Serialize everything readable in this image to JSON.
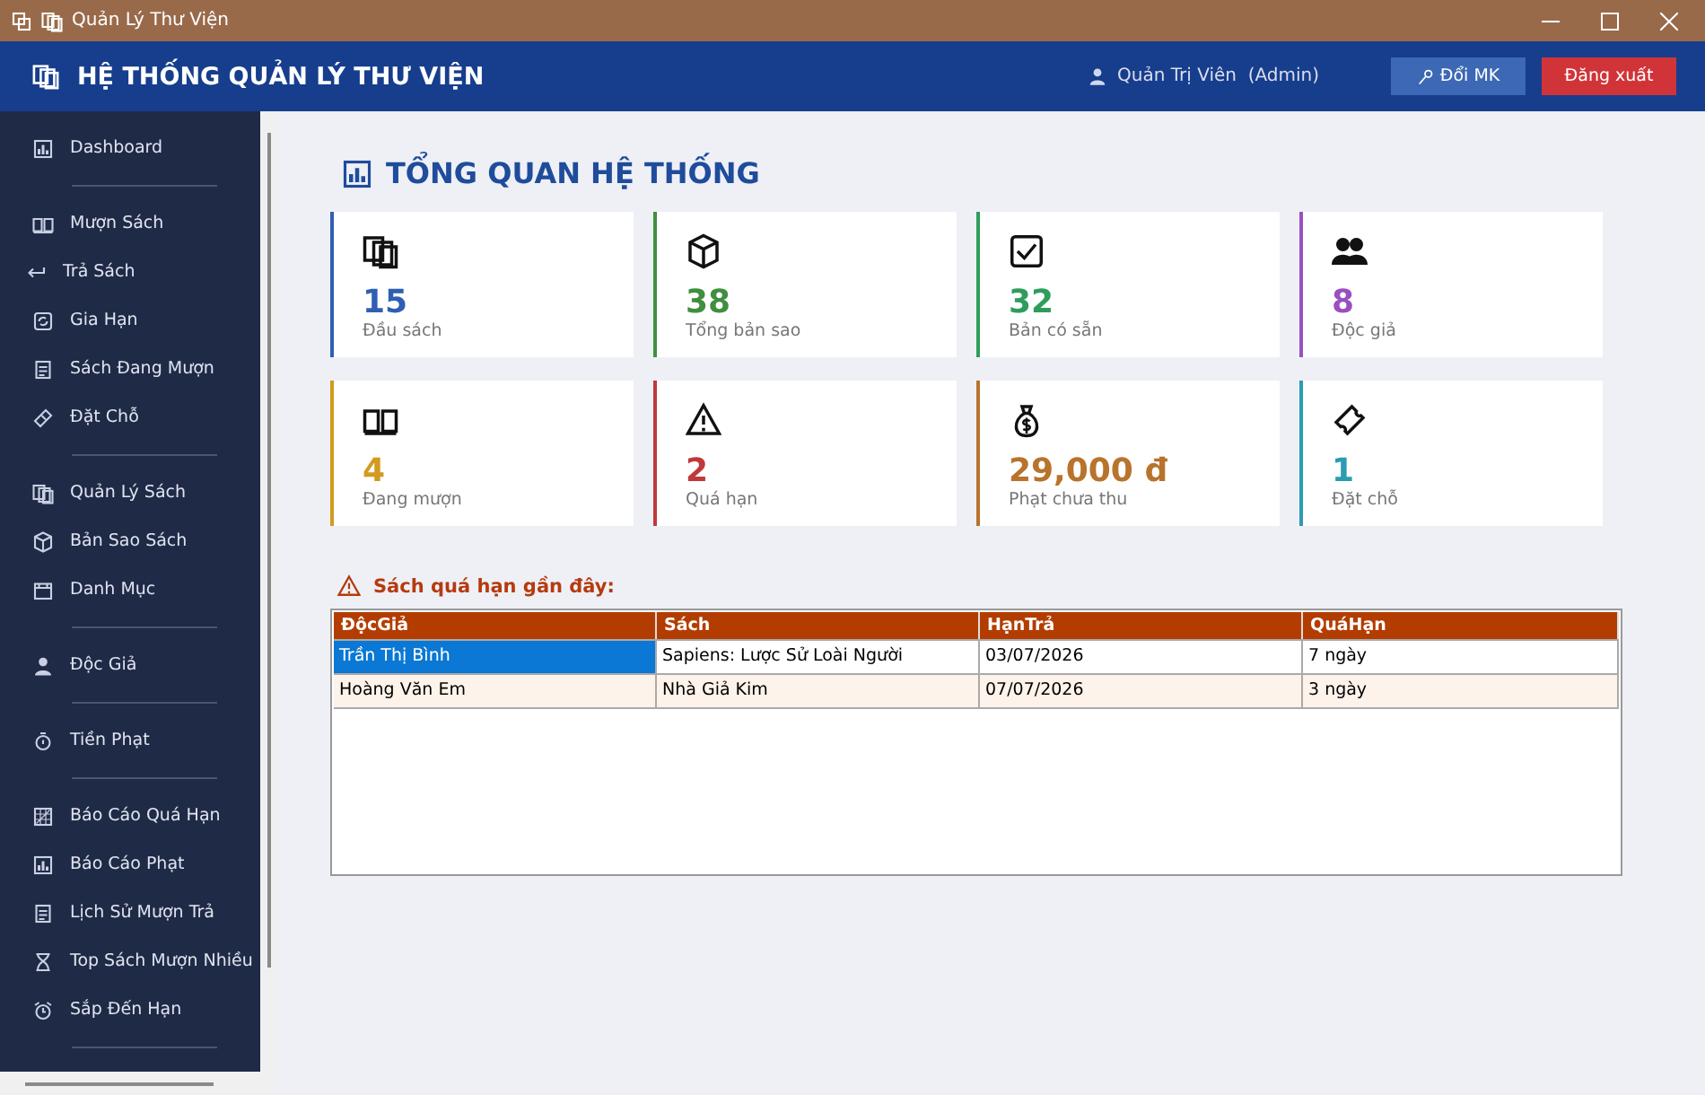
{
  "window": {
    "title": "Quản Lý Thư Viện"
  },
  "header": {
    "title": "HỆ THỐNG QUẢN LÝ THƯ VIỆN",
    "user": "Quản Trị Viên  (Admin)",
    "buttons": [
      "Đổi MK",
      "Đăng xuất"
    ]
  },
  "sidebar": {
    "items": [
      {
        "kind": "item",
        "label": "Dashboard"
      },
      {
        "kind": "separator"
      },
      {
        "kind": "item",
        "label": "Mượn Sách"
      },
      {
        "kind": "item",
        "label": "Trả Sách"
      },
      {
        "kind": "item",
        "label": "Gia Hạn"
      },
      {
        "kind": "item",
        "label": "Sách Đang Mượn"
      },
      {
        "kind": "item",
        "label": "Đặt Chỗ"
      },
      {
        "kind": "separator"
      },
      {
        "kind": "item",
        "label": "Quản Lý Sách"
      },
      {
        "kind": "item",
        "label": "Bản Sao Sách"
      },
      {
        "kind": "item",
        "label": "Danh Mục"
      },
      {
        "kind": "separator"
      },
      {
        "kind": "item",
        "label": "Độc Giả"
      },
      {
        "kind": "separator"
      },
      {
        "kind": "item",
        "label": "Tiền Phạt"
      },
      {
        "kind": "separator"
      },
      {
        "kind": "item",
        "label": "Báo Cáo Quá Hạn"
      },
      {
        "kind": "item",
        "label": "Báo Cáo Phạt"
      },
      {
        "kind": "item",
        "label": "Lịch Sử Mượn Trả"
      },
      {
        "kind": "item",
        "label": "Top Sách Mượn Nhiều"
      },
      {
        "kind": "item",
        "label": "Sắp Đến Hạn"
      },
      {
        "kind": "separator"
      }
    ]
  },
  "overview": {
    "title": "TỔNG QUAN HỆ THỐNG",
    "cards": [
      {
        "value": "15",
        "label": "Đầu sách",
        "color": "#2f5fb3"
      },
      {
        "value": "38",
        "label": "Tổng bản sao",
        "color": "#3f8f3f"
      },
      {
        "value": "32",
        "label": "Bản có sẵn",
        "color": "#2e9d5c"
      },
      {
        "value": "8",
        "label": "Độc giả",
        "color": "#9a4fc0"
      },
      {
        "value": "4",
        "label": "Đang mượn",
        "color": "#d39a1f"
      },
      {
        "value": "2",
        "label": "Quá hạn",
        "color": "#c0393b"
      },
      {
        "value": "29,000 đ",
        "label": "Phạt chưa thu",
        "color": "#b8732c"
      },
      {
        "value": "1",
        "label": "Đặt chỗ",
        "color": "#2a9bb3"
      }
    ]
  },
  "overdue": {
    "title": "Sách quá hạn gần đây:",
    "table": {
      "columns": [
        "ĐộcGiả",
        "Sách",
        "HạnTrả",
        "QuáHạn"
      ],
      "rows": [
        {
          "selected": true,
          "cells": [
            "Trần Thị Bình",
            "Sapiens: Lược Sử Loài Người",
            "03/07/2026",
            "7 ngày"
          ]
        },
        {
          "selected": false,
          "cells": [
            "Hoàng Văn Em",
            "Nhà Giả Kim",
            "07/07/2026",
            "3 ngày"
          ]
        }
      ]
    }
  }
}
